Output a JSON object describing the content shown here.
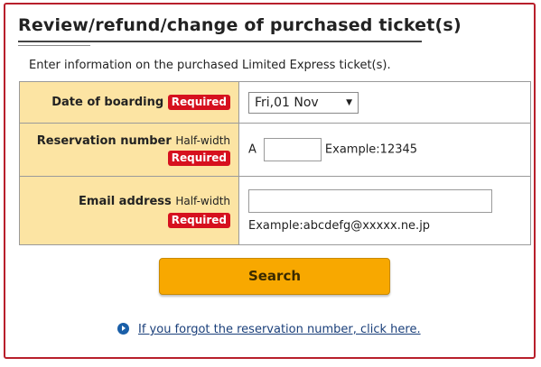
{
  "page": {
    "title": "Review/refund/change of purchased ticket(s)",
    "intro": "Enter information on the purchased Limited Express ticket(s)."
  },
  "form": {
    "boarding": {
      "label": "Date of boarding",
      "required": "Required",
      "selected_date": "Fri,01 Nov"
    },
    "reservation": {
      "label": "Reservation number",
      "note": "Half-width",
      "required": "Required",
      "prefix": "A",
      "value": "",
      "example": "Example:12345"
    },
    "email": {
      "label": "Email address",
      "note": "Half-width",
      "required": "Required",
      "value": "",
      "example": "Example:abcdefg@xxxxx.ne.jp"
    }
  },
  "actions": {
    "search_label": "Search",
    "forgot_link": "If you forgot the reservation number, click here."
  },
  "colors": {
    "border": "#b81f2b",
    "label_bg": "#fce4a3",
    "required_badge": "#d6101e",
    "search_button": "#f8a800",
    "link": "#1a3f7a"
  },
  "icons": {
    "link_bullet": "circle-arrow-right-icon",
    "dropdown": "triangle-down-icon"
  }
}
